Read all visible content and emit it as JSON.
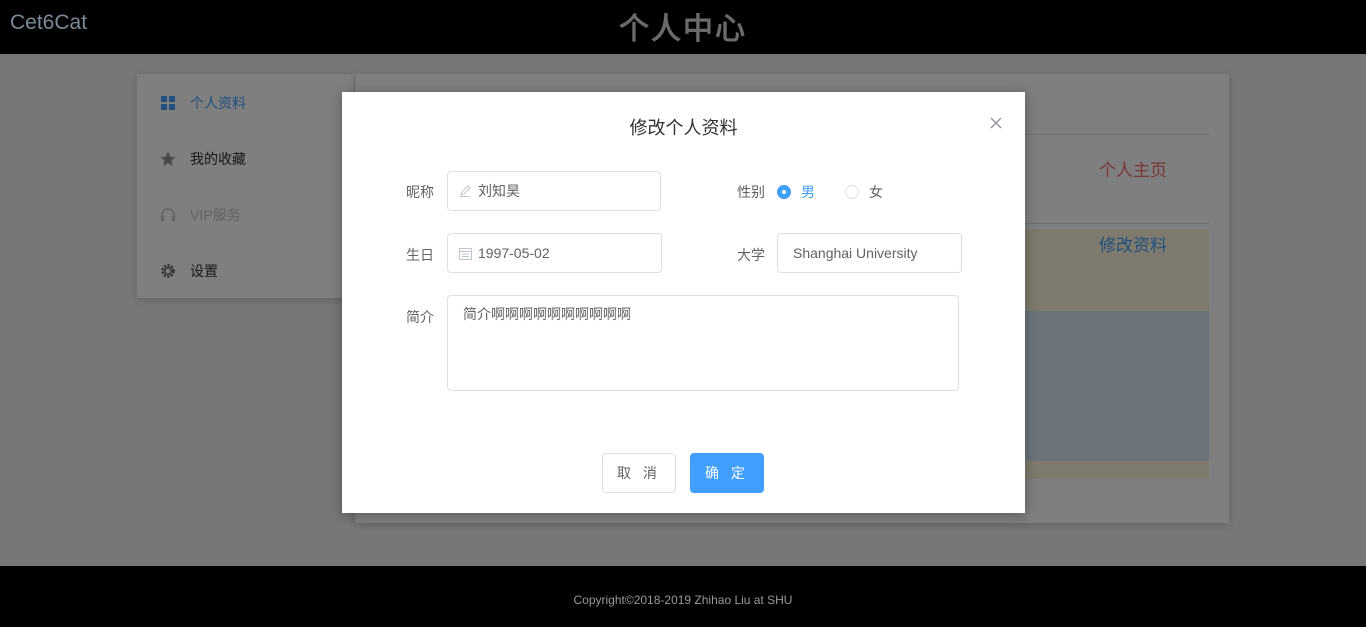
{
  "header": {
    "brand": "Cet6Cat",
    "page_title": "个人中心"
  },
  "sidebar": {
    "items": [
      {
        "label": "个人资料",
        "icon": "grid-icon",
        "state": "active"
      },
      {
        "label": "我的收藏",
        "icon": "star-icon",
        "state": "normal"
      },
      {
        "label": "VIP服务",
        "icon": "headset-icon",
        "state": "disabled"
      },
      {
        "label": "设置",
        "icon": "gear-icon",
        "state": "normal"
      }
    ]
  },
  "profile_card": {
    "home_link": "个人主页",
    "edit_link": "修改资料"
  },
  "dialog": {
    "title": "修改个人资料",
    "fields": {
      "nickname_label": "昵称",
      "nickname_value": "刘知昊",
      "gender_label": "性别",
      "gender_options": [
        "男",
        "女"
      ],
      "gender_selected": "男",
      "birthday_label": "生日",
      "birthday_value": "1997-05-02",
      "university_label": "大学",
      "university_value": "Shanghai University",
      "bio_label": "简介",
      "bio_value": "简介啊啊啊啊啊啊啊啊啊啊"
    },
    "cancel_label": "取 消",
    "confirm_label": "确 定"
  },
  "footer": {
    "copyright": "Copyright©2018-2019 Zhihao Liu at SHU"
  },
  "colors": {
    "accent": "#409eff",
    "danger": "#f56c6c",
    "topbar": "#000000"
  }
}
